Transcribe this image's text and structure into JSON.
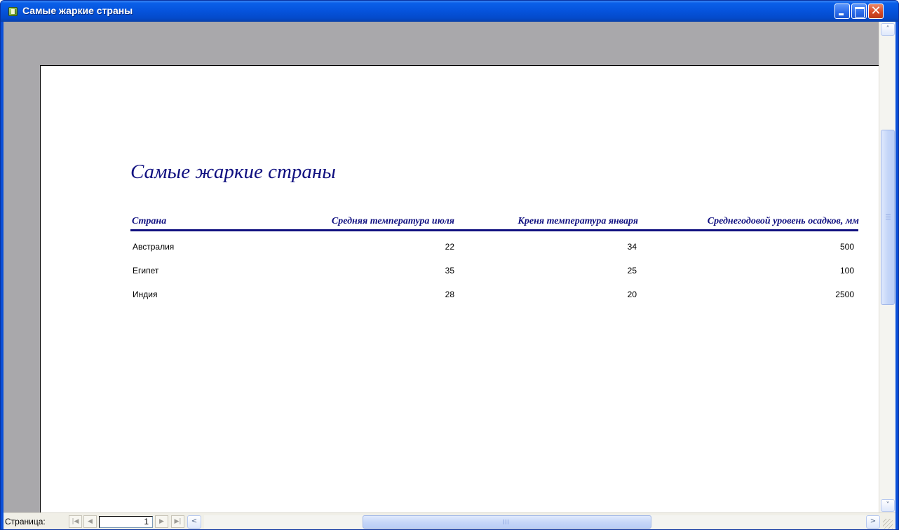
{
  "window": {
    "title": "Самые жаркие страны",
    "minimize_label": "",
    "maximize_label": "",
    "close_label": "✕"
  },
  "report": {
    "title": "Самые жаркие страны",
    "columns": [
      "Страна",
      "Средняя температура июля",
      "Креня температура января",
      "Среднегодовой уровень осадков, мм"
    ],
    "rows": [
      {
        "country": "Австралия",
        "july": "22",
        "january": "34",
        "precipitation": "500"
      },
      {
        "country": "Египет",
        "july": "35",
        "january": "25",
        "precipitation": "100"
      },
      {
        "country": "Индия",
        "july": "28",
        "january": "20",
        "precipitation": "2500"
      }
    ]
  },
  "navigation": {
    "page_label": "Страница:",
    "current_page": "1",
    "first_symbol": "|◀",
    "prev_symbol": "◀",
    "next_symbol": "▶",
    "last_symbol": "▶|"
  },
  "scrollbars": {
    "up_symbol": "˄",
    "down_symbol": "˅",
    "left_symbol": "<",
    "right_symbol": ">"
  },
  "colors": {
    "report_text": "#101080",
    "titlebar": "#0553dc",
    "canvas": "#a9a8ab"
  }
}
